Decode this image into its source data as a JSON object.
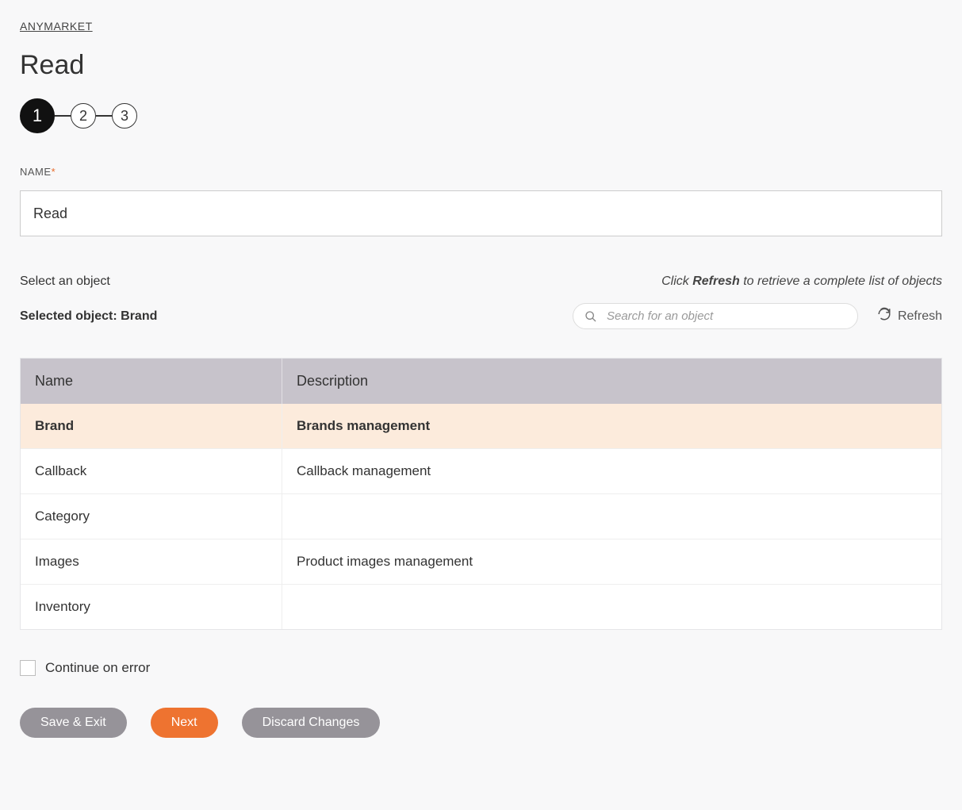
{
  "breadcrumb": "ANYMARKET",
  "page_title": "Read",
  "stepper": {
    "steps": [
      "1",
      "2",
      "3"
    ],
    "active_index": 0
  },
  "name_field": {
    "label": "NAME",
    "required": "*",
    "value": "Read"
  },
  "select_object_label": "Select an object",
  "refresh_hint_prefix": "Click ",
  "refresh_hint_bold": "Refresh",
  "refresh_hint_suffix": " to retrieve a complete list of objects",
  "selected_object_label": "Selected object: Brand",
  "search_placeholder": "Search for an object",
  "refresh_label": "Refresh",
  "table": {
    "headers": {
      "name": "Name",
      "description": "Description"
    },
    "rows": [
      {
        "name": "Brand",
        "description": "Brands management",
        "selected": true
      },
      {
        "name": "Callback",
        "description": "Callback management"
      },
      {
        "name": "Category",
        "description": ""
      },
      {
        "name": "Images",
        "description": "Product images management"
      },
      {
        "name": "Inventory",
        "description": ""
      }
    ]
  },
  "continue_on_error_label": "Continue on error",
  "buttons": {
    "save_exit": "Save & Exit",
    "next": "Next",
    "discard": "Discard Changes"
  }
}
